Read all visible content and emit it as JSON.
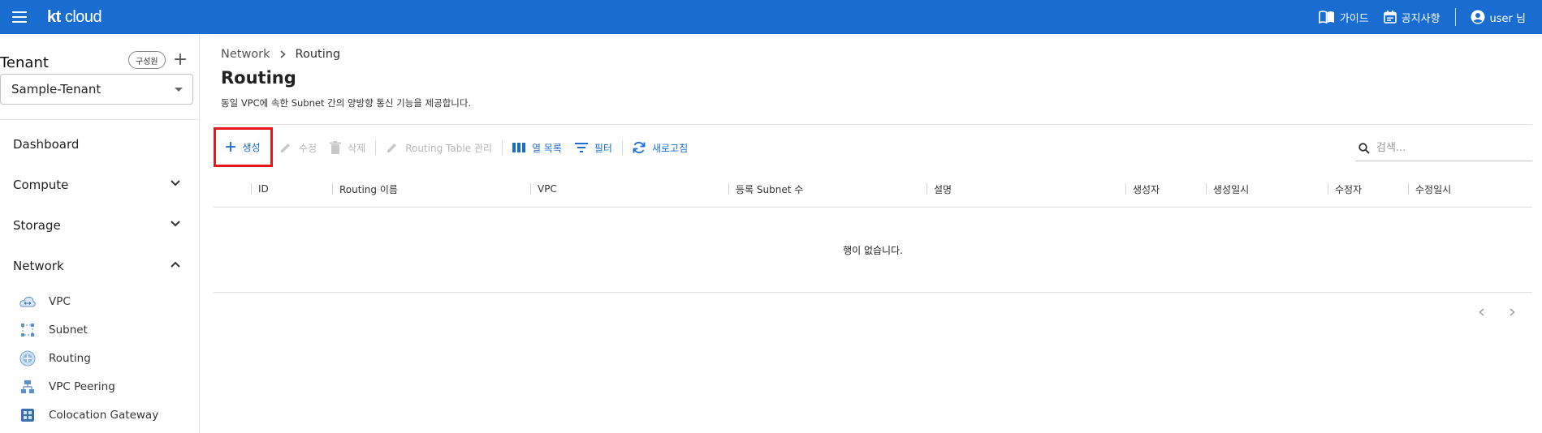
{
  "topbar": {
    "logo_bold": "kt",
    "logo_rest": "cloud",
    "guide_label": "가이드",
    "notice_label": "공지사항",
    "user_label": "user 님"
  },
  "sidebar": {
    "tenant_label": "Tenant",
    "member_chip": "구성원",
    "add_symbol": "+",
    "selected_tenant": "Sample-Tenant",
    "nav": [
      {
        "label": "Dashboard"
      },
      {
        "label": "Compute"
      },
      {
        "label": "Storage"
      },
      {
        "label": "Network"
      }
    ],
    "network_items": [
      {
        "label": "VPC",
        "icon": "vpc-icon"
      },
      {
        "label": "Subnet",
        "icon": "subnet-icon"
      },
      {
        "label": "Routing",
        "icon": "routing-icon"
      },
      {
        "label": "VPC Peering",
        "icon": "vpc-peering-icon"
      },
      {
        "label": "Colocation Gateway",
        "icon": "colocation-gateway-icon"
      }
    ]
  },
  "main": {
    "breadcrumb_parent": "Network",
    "breadcrumb_current": "Routing",
    "title": "Routing",
    "description": "동일 VPC에 속한 Subnet 간의 양방향 통신 기능을 제공합니다."
  },
  "toolbar": {
    "create_label": "생성",
    "edit_label": "수정",
    "delete_label": "삭제",
    "manage_label": "Routing Table 관리",
    "columns_label": "열 목록",
    "filter_label": "필터",
    "refresh_label": "새로고침",
    "search_placeholder": "검색..."
  },
  "table": {
    "columns": [
      "ID",
      "Routing 이름",
      "VPC",
      "등록 Subnet 수",
      "설명",
      "생성자",
      "생성일시",
      "수정자",
      "수정일시"
    ],
    "empty_message": "행이 없습니다."
  },
  "colors": {
    "brand": "#1a6dd0",
    "highlight": "#e8161b",
    "disabled": "#b5b5b5"
  }
}
